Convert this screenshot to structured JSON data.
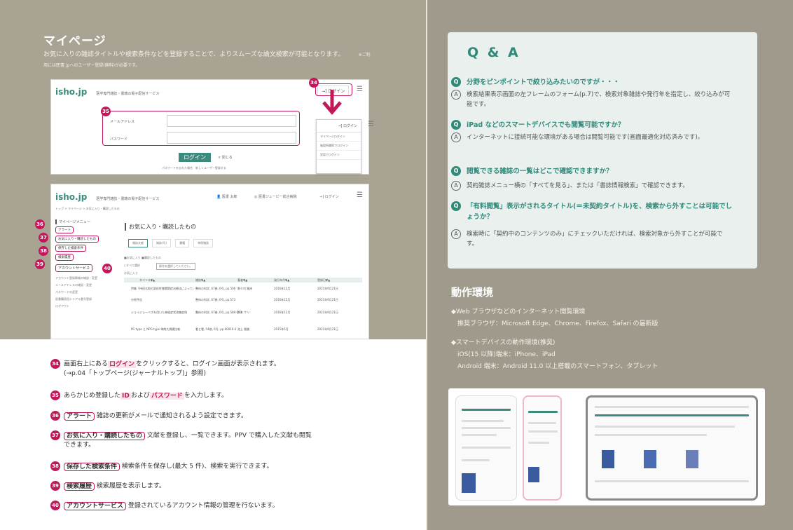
{
  "mypage": {
    "title": "マイページ",
    "desc": "お気に入りの雑誌タイトルや検索条件などを登録することで、よりスムーズな論文検索が可能となります。",
    "note": "※ご利用には医書.jpへのユーザー登録(無料)が必要です。"
  },
  "shot1": {
    "logo": "isho.jp",
    "tagline": "医学専門雑誌・書籍の電子配信サービス",
    "login": "ログイン",
    "email_label": "メールアドレス",
    "password_label": "パスワード",
    "login_btn": "ログイン",
    "close": "× 閉じる",
    "forgot": "パスワードを忘れた場合　新しくユーザー登録する",
    "menu": [
      "マイページログイン",
      "施設所属IDでログイン",
      "学認でログイン"
    ]
  },
  "shot2": {
    "logo": "isho.jp",
    "tagline": "医学専門雑誌・書籍の電子配信サービス",
    "user": "医書 太郎",
    "org": "医書ジュービー総合病院",
    "login": "ログイン",
    "breadcrumb": "トップ > マイページ > お気に入り・購読したもの",
    "side_title": "マイページメニュー",
    "side": [
      "アラート",
      "お気に入り・購読したもの",
      "保存した検索条件",
      "検索履歴"
    ],
    "account_title": "アカウントサービス",
    "account_items": [
      "アカウント登録情報の確認・変更",
      "メールアドレスの確認・変更",
      "パスワードの変更",
      "医書購読用シリアル番号登録",
      "ログアウト"
    ],
    "main_title": "お気に入り・購読したもの",
    "tabs": [
      "雑誌文献",
      "雑誌(号)",
      "書籍",
      "単冊雑誌"
    ],
    "filters": "■お気に入り ■購読したもの",
    "select_all": "○すべて選択",
    "select_placeholder": "操作を選択してください。",
    "fav_label": "お気に入り",
    "cols": [
      "タイトル▼▲",
      "雑誌▼▲",
      "著者▼▲",
      "発行年月▼▲",
      "登録日▼▲"
    ],
    "rows": [
      [
        "特集「持田太郎の変形性膝関節症治療法によって」",
        "整体の科学, 67巻, 6号, pp.506",
        "野々村 雅彦",
        "2016年12月",
        "2021年9月21日"
      ],
      [
        "分冊予告",
        "整体の科学, 67巻, 6号, pp.573",
        "",
        "2016年12月",
        "2021年9月21日"
      ],
      [
        "ジョイジョーベスを用いた神経症状改善症例",
        "整体の科学, 67巻, 6号, pp.589-593",
        "鈴木 サリ",
        "2016年12月",
        "2021年9月21日"
      ],
      [
        "PG type と NPG type 単剤大規模比較",
        "看と看, 54巻, 6号, pp.00010-00011",
        "池上 雅美",
        "2015年5月",
        "2021年9月21日"
      ]
    ]
  },
  "callouts": [
    "34",
    "35",
    "36",
    "37",
    "38",
    "39",
    "40"
  ],
  "explanations": [
    {
      "num": "34",
      "pre": "画面右上にある",
      "hl": "ログイン",
      "post": "をクリックすると、ログイン画面が表示されます。",
      "line2": "(→p.04「トップページ(ジャーナルトップ)」参照)"
    },
    {
      "num": "35",
      "pre": "あらかじめ登録した",
      "hl": "ID",
      "mid": "および",
      "hl2": "パスワード",
      "post": "を入力します。"
    },
    {
      "num": "36",
      "box": "アラート",
      "post": "雑誌の更新がメールで通知されるよう設定できます。"
    },
    {
      "num": "37",
      "box": "お気に入り・購読したもの",
      "post": "文献を登録し、一覧できます。PPV で購入した文献も閲覧",
      "line2": "できます。"
    },
    {
      "num": "38",
      "box": "保存した検索条件",
      "post": "検索条件を保存し(最大 5 件)、検索を実行できます。"
    },
    {
      "num": "39",
      "box": "検索履歴",
      "post": "検索履歴を表示します。"
    },
    {
      "num": "40",
      "box": "アカウントサービス",
      "post": "登録されているアカウント情報の管理を行ないます。"
    }
  ],
  "qa": {
    "title": "Q & A",
    "items": [
      {
        "q": "分野をピンポイントで絞り込みたいのですが・・・",
        "a": "検索結果表示画面の左フレームのフォーム(p.7)で、検索対象雑誌や発行年を指定し、絞り込みが可能です。"
      },
      {
        "q": "iPad などのスマートデバイスでも閲覧可能ですか？",
        "a": "インターネットに接続可能な環境がある場合は閲覧可能です(画面最適化対応済みです)。"
      },
      {
        "q": "閲覧できる雑誌の一覧はどこで確認できますか？",
        "a": "契約雑誌メニュー横の「すべてを見る」、または「書誌情報検索」で確認できます。"
      },
      {
        "q": "「有料閲覧」表示がされるタイトル(＝未契約タイトル)を、検索から外すことは可能でしょうか？",
        "a": "検索時に「契約中のコンテンツのみ」にチェックいただければ、検索対象から外すことが可能です。"
      }
    ],
    "q_mark": "Q",
    "a_mark": "A"
  },
  "env": {
    "title": "動作環境",
    "lines": [
      "◆Web ブラウザなどのインターネット閲覧環境",
      "　推奨ブラウザ：Microsoft Edge、Chrome、Firefox、Safari の最新版",
      "◆スマートデバイスの動作環境(推奨)",
      "　iOS(15 以降)端末：iPhone、iPad",
      "　Android 端末：Android 11.0 以上搭載のスマートフォン、タブレット"
    ]
  },
  "colors": {
    "accent": "#c2185b",
    "teal": "#2f8a7a",
    "bg": "#a9a393"
  }
}
